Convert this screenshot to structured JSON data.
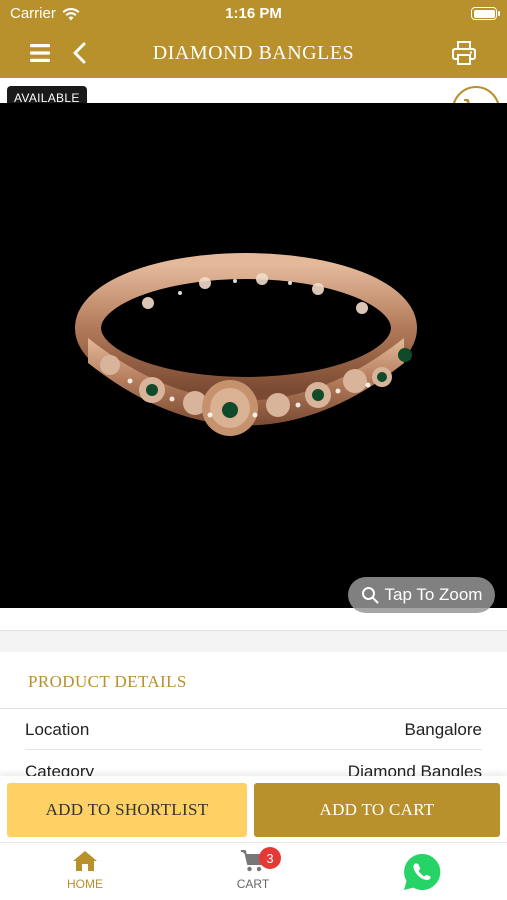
{
  "status_bar": {
    "carrier": "Carrier",
    "time": "1:16 PM"
  },
  "nav": {
    "title": "DIAMOND BANGLES"
  },
  "product": {
    "availability": "AVAILABLE",
    "zoom_label": "Tap To Zoom"
  },
  "details": {
    "title": "PRODUCT DETAILS",
    "rows": [
      {
        "label": "Location",
        "value": "Bangalore"
      },
      {
        "label": "Category",
        "value": "Diamond Bangles"
      }
    ]
  },
  "actions": {
    "shortlist_label": "ADD TO SHORTLIST",
    "add_to_cart_label": "ADD TO CART"
  },
  "tabs": {
    "home_label": "HOME",
    "cart_label": "CART",
    "cart_count": "3"
  },
  "colors": {
    "brand_gold": "#b8902c",
    "shortlist_yellow": "#fdd163",
    "badge_red": "#e53935",
    "whatsapp_green": "#25d366"
  },
  "icons": [
    "menu-icon",
    "back-arrow-icon",
    "print-icon",
    "cart-icon",
    "search-icon",
    "home-icon",
    "whatsapp-icon",
    "wifi-icon",
    "battery-icon"
  ]
}
